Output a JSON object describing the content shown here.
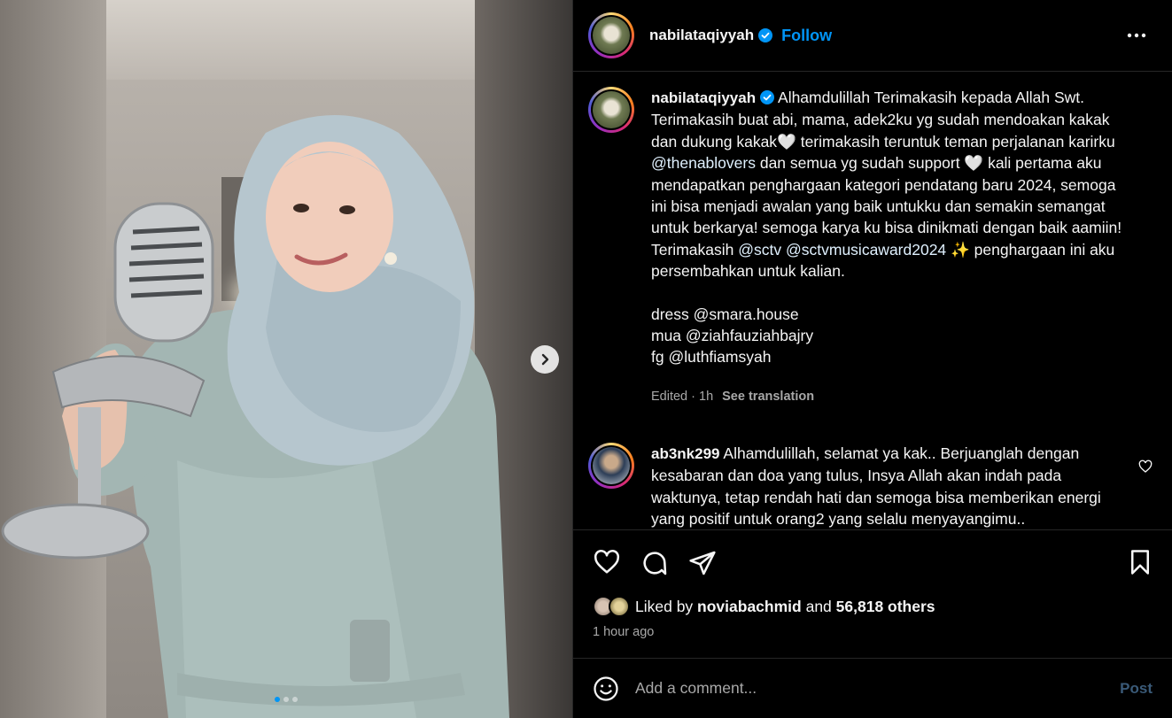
{
  "post": {
    "username": "nabilataqiyyah",
    "follow_label": "Follow",
    "more_icon": "more-horizontal-icon",
    "verified_color": "#0095f6"
  },
  "caption": {
    "username": "nabilataqiyyah",
    "line1": "Alhamdulillah Terimakasih kepada Allah Swt. Terimakasih buat abi, mama, adek2ku yg sudah mendoakan kakak dan dukung kakak🤍  terimakasih teruntuk teman perjalanan karirku ",
    "mention1": "@thenablovers",
    "line2": " dan semua yg sudah support 🤍 kali pertama aku mendapatkan penghargaan kategori pendatang baru 2024, semoga ini bisa menjadi awalan yang baik untukku dan semakin semangat untuk berkarya! semoga karya ku bisa dinikmati dengan baik aamiin! Terimakasih ",
    "mention2": "@sctv",
    "line3": " ",
    "mention3": "@sctvmusicaward2024",
    "line4": " ✨  penghargaan ini aku persembahkan untuk kalian.",
    "dress": "dress @smara.house",
    "mua": "mua @ziahfauziahbajry",
    "fg": "fg @luthfiamsyah",
    "edited": "Edited · 1h",
    "see_translation": "See translation"
  },
  "comment": {
    "username": "ab3nk299",
    "text": " Alhamdulillah, selamat ya kak.. Berjuanglah dengan kesabaran dan doa yang tulus, Insya Allah akan indah pada waktunya, tetap rendah hati dan semoga bisa memberikan energi yang positif untuk orang2 yang selalu menyayangimu.."
  },
  "likes": {
    "prefix": "Liked by ",
    "liker": "noviabachmid",
    "middle": " and ",
    "count": "56,818 others"
  },
  "time_ago": "1 hour ago",
  "comment_box": {
    "placeholder": "Add a comment...",
    "post_label": "Post"
  },
  "carousel": {
    "slide_count": 3,
    "active_index": 0
  },
  "colors": {
    "accent": "#0095f6",
    "background": "#000000",
    "muted_text": "#a8a8a8"
  }
}
